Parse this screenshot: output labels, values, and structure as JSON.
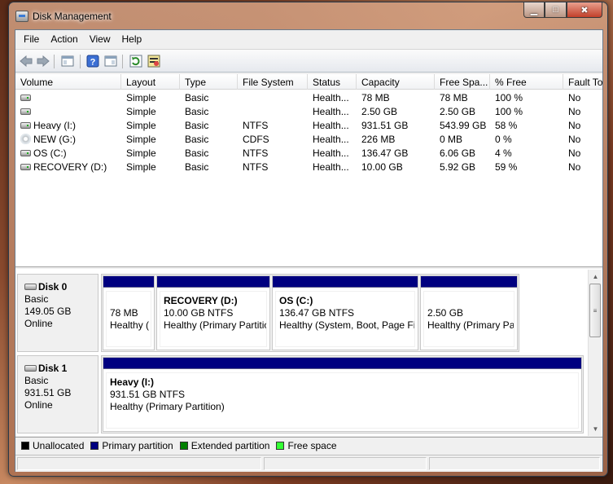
{
  "window": {
    "title": "Disk Management"
  },
  "menu": [
    "File",
    "Action",
    "View",
    "Help"
  ],
  "toolbar": {
    "buttons": [
      "back-arrow-icon",
      "forward-arrow-icon",
      "console-tree-icon",
      "help-icon",
      "properties-icon",
      "refresh-icon",
      "rescan-icon"
    ]
  },
  "volumes": {
    "columns": [
      "Volume",
      "Layout",
      "Type",
      "File System",
      "Status",
      "Capacity",
      "Free Spa...",
      "% Free",
      "Fault To"
    ],
    "rows": [
      {
        "volume": "",
        "icon": "drive",
        "layout": "Simple",
        "type": "Basic",
        "fs": "",
        "status": "Health...",
        "capacity": "78 MB",
        "free": "78 MB",
        "pct": "100 %",
        "fault": "No"
      },
      {
        "volume": "",
        "icon": "drive",
        "layout": "Simple",
        "type": "Basic",
        "fs": "",
        "status": "Health...",
        "capacity": "2.50 GB",
        "free": "2.50 GB",
        "pct": "100 %",
        "fault": "No"
      },
      {
        "volume": "Heavy (I:)",
        "icon": "drive",
        "layout": "Simple",
        "type": "Basic",
        "fs": "NTFS",
        "status": "Health...",
        "capacity": "931.51 GB",
        "free": "543.99 GB",
        "pct": "58 %",
        "fault": "No"
      },
      {
        "volume": "NEW (G:)",
        "icon": "cd",
        "layout": "Simple",
        "type": "Basic",
        "fs": "CDFS",
        "status": "Health...",
        "capacity": "226 MB",
        "free": "0 MB",
        "pct": "0 %",
        "fault": "No"
      },
      {
        "volume": "OS (C:)",
        "icon": "drive",
        "layout": "Simple",
        "type": "Basic",
        "fs": "NTFS",
        "status": "Health...",
        "capacity": "136.47 GB",
        "free": "6.06 GB",
        "pct": "4 %",
        "fault": "No"
      },
      {
        "volume": "RECOVERY (D:)",
        "icon": "drive",
        "layout": "Simple",
        "type": "Basic",
        "fs": "NTFS",
        "status": "Health...",
        "capacity": "10.00 GB",
        "free": "5.92 GB",
        "pct": "59 %",
        "fault": "No"
      }
    ]
  },
  "disks": [
    {
      "name": "Disk 0",
      "kind": "Basic",
      "size": "149.05 GB",
      "state": "Online",
      "partitions": [
        {
          "name": "",
          "size": "78 MB",
          "status": "Healthy ("
        },
        {
          "name": "RECOVERY  (D:)",
          "size": "10.00 GB NTFS",
          "status": "Healthy (Primary Partitio"
        },
        {
          "name": "OS  (C:)",
          "size": "136.47 GB NTFS",
          "status": "Healthy (System, Boot, Page File"
        },
        {
          "name": "",
          "size": "2.50 GB",
          "status": "Healthy (Primary Par"
        }
      ]
    },
    {
      "name": "Disk 1",
      "kind": "Basic",
      "size": "931.51 GB",
      "state": "Online",
      "partitions": [
        {
          "name": "Heavy  (I:)",
          "size": "931.51 GB NTFS",
          "status": "Healthy (Primary Partition)"
        }
      ]
    }
  ],
  "legend": [
    {
      "label": "Unallocated",
      "color": "#000000"
    },
    {
      "label": "Primary partition",
      "color": "#000080"
    },
    {
      "label": "Extended partition",
      "color": "#008000"
    },
    {
      "label": "Free space",
      "color": "#33ff33"
    }
  ]
}
